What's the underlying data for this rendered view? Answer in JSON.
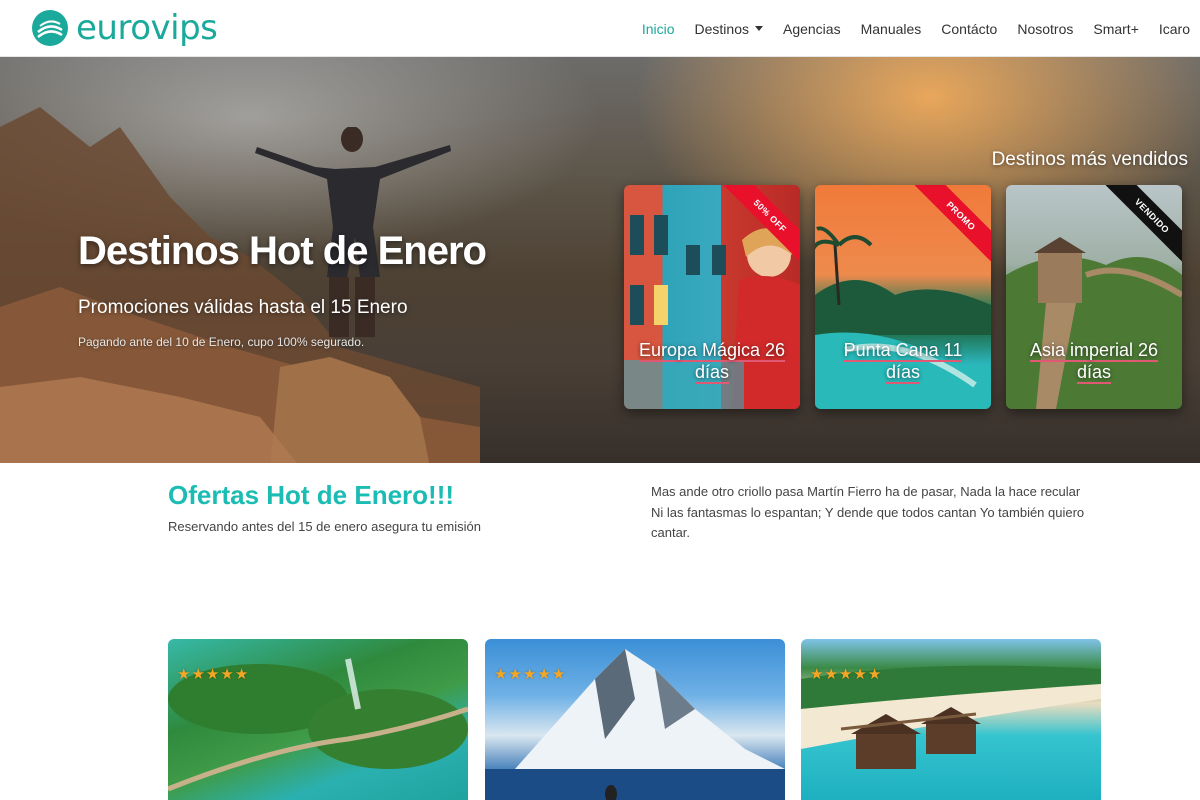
{
  "brand": {
    "name": "eurovips",
    "color": "#1aa99a"
  },
  "nav": {
    "items": [
      {
        "label": "Inicio",
        "active": true
      },
      {
        "label": "Destinos",
        "dropdown": true
      },
      {
        "label": "Agencias"
      },
      {
        "label": "Manuales"
      },
      {
        "label": "Contácto"
      },
      {
        "label": "Nosotros"
      },
      {
        "label": "Smart+"
      },
      {
        "label": "Icaro"
      }
    ]
  },
  "hero": {
    "title": "Destinos Hot de Enero",
    "subtitle": "Promociones válidas hasta el 15 Enero",
    "note": "Pagando ante del 10 de Enero, cupo 100% segurado.",
    "bestsellers_heading": "Destinos más vendidos",
    "cards": [
      {
        "label": "Europa Mágica 26 días",
        "ribbon": "50% OFF",
        "ribbon_color": "red"
      },
      {
        "label": "Punta Cana 11 días",
        "ribbon": "PROMO",
        "ribbon_color": "red"
      },
      {
        "label": "Asia imperial 26 días",
        "ribbon": "VENDIDO",
        "ribbon_color": "black"
      }
    ]
  },
  "offers": {
    "title": "Ofertas Hot de Enero!!!",
    "subtitle": "Reservando antes del 15 de enero asegura tu emisión",
    "text": "Mas ande otro criollo pasa Martín Fierro ha de pasar, Nada la hace recular Ni las fantasmas lo espantan; Y dende que todos cantan Yo también quiero cantar."
  },
  "tours": [
    {
      "stars": 5,
      "icon": "lakes-waterfall-image"
    },
    {
      "stars": 5,
      "icon": "antarctica-mountain-image"
    },
    {
      "stars": 5,
      "icon": "tropical-beach-image"
    }
  ],
  "colors": {
    "accent": "#1abcb4",
    "ribbon_red": "#e8102a",
    "star": "#f5a623"
  }
}
